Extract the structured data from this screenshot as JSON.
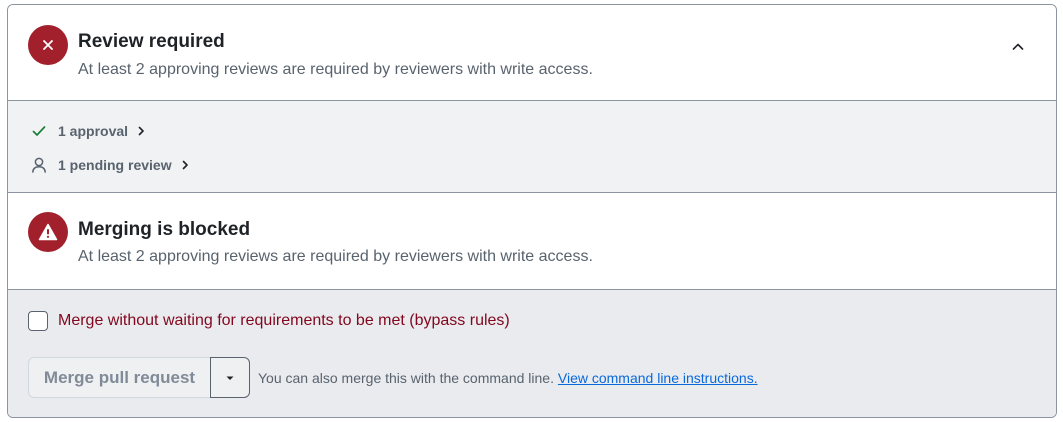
{
  "review": {
    "icon": "x-icon",
    "title": "Review required",
    "subtitle": "At least 2 approving reviews are required by reviewers with write access.",
    "collapse_icon": "chevron-up-icon"
  },
  "details": {
    "items": [
      {
        "icon": "check-icon",
        "label": "1 approval"
      },
      {
        "icon": "person-icon",
        "label": "1 pending review"
      }
    ]
  },
  "blocked": {
    "icon": "alert-icon",
    "title": "Merging is blocked",
    "subtitle": "At least 2 approving reviews are required by reviewers with write access."
  },
  "merge": {
    "bypass_label": "Merge without waiting for requirements to be met (bypass rules)",
    "bypass_checked": false,
    "merge_button_label": "Merge pull request",
    "cli_text": "You can also merge this with the command line.",
    "cli_link": "View command line instructions."
  },
  "colors": {
    "danger": "#a1202c",
    "success": "#1a7f37",
    "link": "#0969da",
    "bypass_text": "#82071e"
  }
}
